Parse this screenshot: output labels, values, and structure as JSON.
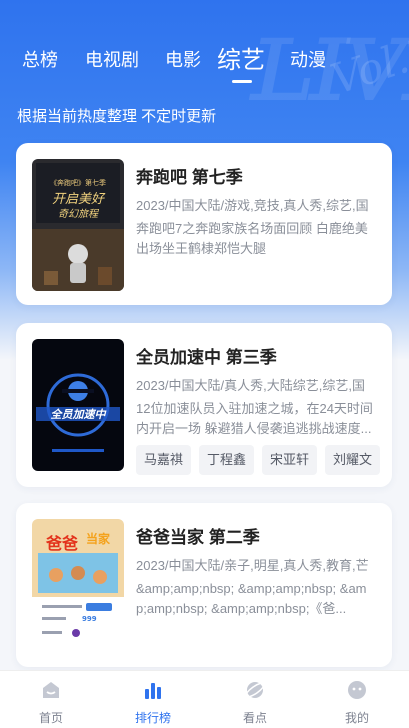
{
  "tabs": [
    {
      "label": "总榜"
    },
    {
      "label": "电视剧"
    },
    {
      "label": "电影"
    },
    {
      "label": "综艺",
      "active": true
    },
    {
      "label": "动漫"
    }
  ],
  "subtitle": "根据当前热度整理 不定时更新",
  "shows": [
    {
      "title": "奔跑吧 第七季",
      "meta": "2023/中国大陆/游戏,竞技,真人秀,综艺,国",
      "desc": "奔跑吧7之奔跑家族名场面回顾 白鹿绝美出场坐王鹤棣郑恺大腿",
      "tags": []
    },
    {
      "title": "全员加速中 第三季",
      "meta": "2023/中国大陆/真人秀,大陆综艺,综艺,国",
      "desc": "12位加速队员入驻加速之城，在24天时间内开启一场 躲避猎人侵袭追逃挑战速度...",
      "tags": [
        "马嘉祺",
        "丁程鑫",
        "宋亚轩",
        "刘耀文"
      ]
    },
    {
      "title": "爸爸当家 第二季",
      "meta": "2023/中国大陆/亲子,明星,真人秀,教育,芒",
      "desc": "&amp;amp;nbsp; &amp;amp;nbsp; &amp;amp;nbsp; &amp;amp;nbsp;《爸...",
      "tags": []
    }
  ],
  "nav": [
    {
      "label": "首页",
      "icon": "home-icon"
    },
    {
      "label": "排行榜",
      "icon": "ranking-icon",
      "active": true
    },
    {
      "label": "看点",
      "icon": "planet-icon"
    },
    {
      "label": "我的",
      "icon": "profile-icon"
    }
  ],
  "colors": {
    "accent": "#2f73ee",
    "text": "#222222",
    "muted": "#8a8f99"
  }
}
